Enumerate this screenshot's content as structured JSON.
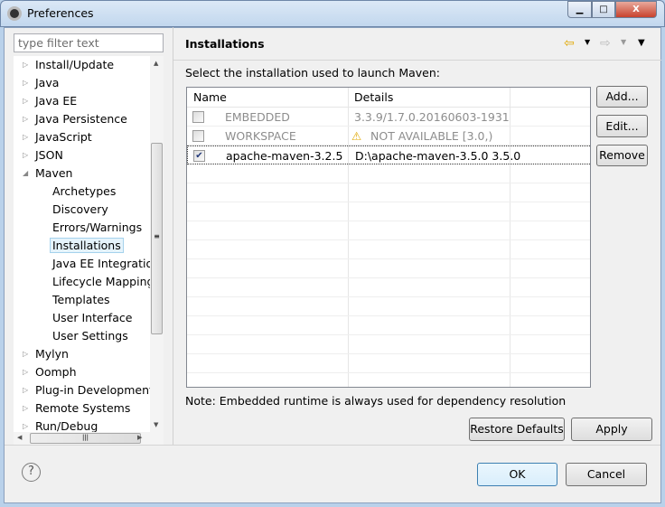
{
  "window": {
    "title": "Preferences",
    "controls": [
      "minimize",
      "maximize",
      "close"
    ]
  },
  "filter": {
    "placeholder": "type filter text"
  },
  "tree": [
    {
      "label": "Install/Update",
      "level": 0,
      "expander": "collapsed"
    },
    {
      "label": "Java",
      "level": 0,
      "expander": "collapsed"
    },
    {
      "label": "Java EE",
      "level": 0,
      "expander": "collapsed"
    },
    {
      "label": "Java Persistence",
      "level": 0,
      "expander": "collapsed"
    },
    {
      "label": "JavaScript",
      "level": 0,
      "expander": "collapsed"
    },
    {
      "label": "JSON",
      "level": 0,
      "expander": "collapsed"
    },
    {
      "label": "Maven",
      "level": 0,
      "expander": "expanded"
    },
    {
      "label": "Archetypes",
      "level": 1
    },
    {
      "label": "Discovery",
      "level": 1
    },
    {
      "label": "Errors/Warnings",
      "level": 1
    },
    {
      "label": "Installations",
      "level": 1,
      "selected": true
    },
    {
      "label": "Java EE Integration",
      "level": 1
    },
    {
      "label": "Lifecycle Mapping",
      "level": 1
    },
    {
      "label": "Templates",
      "level": 1
    },
    {
      "label": "User Interface",
      "level": 1
    },
    {
      "label": "User Settings",
      "level": 1
    },
    {
      "label": "Mylyn",
      "level": 0,
      "expander": "collapsed"
    },
    {
      "label": "Oomph",
      "level": 0,
      "expander": "collapsed"
    },
    {
      "label": "Plug-in Development",
      "level": 0,
      "expander": "collapsed"
    },
    {
      "label": "Remote Systems",
      "level": 0,
      "expander": "collapsed"
    },
    {
      "label": "Run/Debug",
      "level": 0,
      "expander": "collapsed"
    }
  ],
  "page": {
    "title": "Installations",
    "instruction": "Select the installation used to launch Maven:",
    "columns": [
      "Name",
      "Details"
    ],
    "rows": [
      {
        "checked": false,
        "name": "EMBEDDED",
        "details": "3.3.9/1.7.0.20160603-1931",
        "enabled": false,
        "warning": false
      },
      {
        "checked": false,
        "name": "WORKSPACE",
        "details": "NOT AVAILABLE [3.0,)",
        "enabled": false,
        "warning": true
      },
      {
        "checked": true,
        "name": "apache-maven-3.2.5",
        "details": "D:\\apache-maven-3.5.0 3.5.0",
        "enabled": true,
        "warning": false
      }
    ],
    "buttons": {
      "add": "Add...",
      "edit": "Edit...",
      "remove": "Remove"
    },
    "note": "Note: Embedded runtime is always used for dependency resolution",
    "restore_defaults": "Restore Defaults",
    "apply": "Apply"
  },
  "footer": {
    "ok": "OK",
    "cancel": "Cancel",
    "help": "?"
  }
}
